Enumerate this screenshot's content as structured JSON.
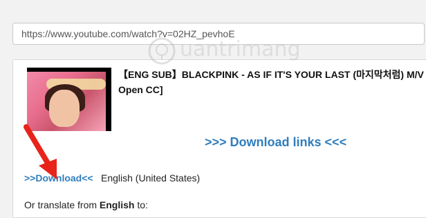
{
  "url_field": {
    "value": "https://www.youtube.com/watch?v=02HZ_pevhoE"
  },
  "video": {
    "title": "【ENG SUB】BLACKPINK - AS IF IT'S YOUR LAST (마지막처럼) M/V\nOpen CC]",
    "download_links_label": ">>> Download links <<<"
  },
  "subtitle_row": {
    "download_label": ">>Download<<",
    "language": "English (United States)"
  },
  "translate": {
    "prefix": "Or translate from ",
    "from_language": "English",
    "suffix": " to:"
  },
  "watermark": {
    "text": "uantrimang"
  },
  "colors": {
    "link": "#2f7dbd",
    "arrow": "#e8231a"
  }
}
